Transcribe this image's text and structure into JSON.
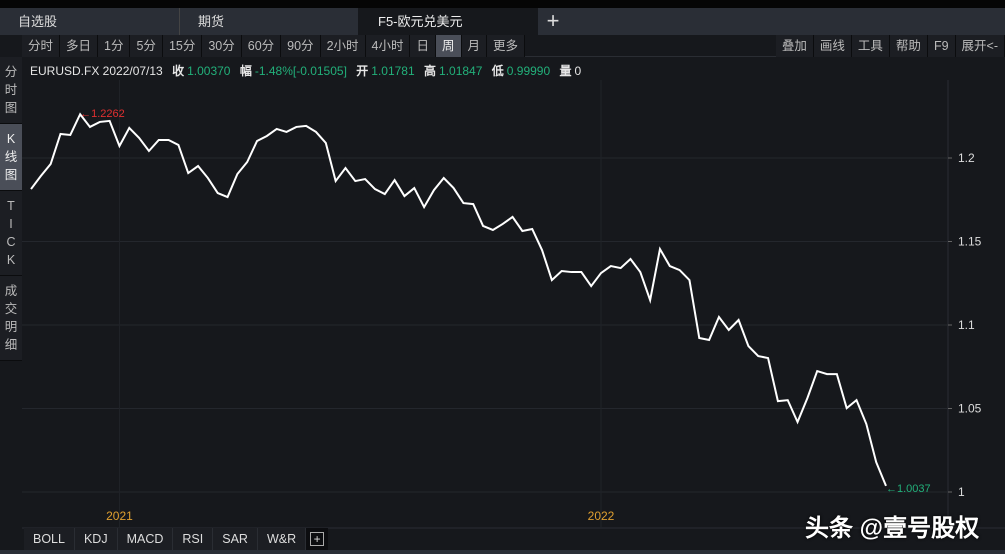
{
  "tabs": [
    {
      "label": "自选股"
    },
    {
      "label": "期货"
    },
    {
      "label": "F5-欧元兑美元 EURUSD.FX"
    }
  ],
  "add_tab": "+",
  "periods": [
    "分时",
    "多日",
    "1分",
    "5分",
    "15分",
    "30分",
    "60分",
    "90分",
    "2小时",
    "4小时",
    "日",
    "周",
    "月",
    "更多"
  ],
  "selected_period": "周",
  "tools": [
    "叠加",
    "画线",
    "工具",
    "帮助",
    "F9",
    "展开<-"
  ],
  "sidebar": [
    "分\n时\n图",
    "K\n线\n图",
    "T\nI\nC\nK",
    "成\n交\n明\n细"
  ],
  "info": {
    "symbol_date": "EURUSD.FX 2022/07/13",
    "close_label": "收",
    "close": "1.00370",
    "change_label": "幅",
    "change": "-1.48%[-0.01505]",
    "open_label": "开",
    "open": "1.01781",
    "high_label": "高",
    "high": "1.01847",
    "low_label": "低",
    "low": "0.99990",
    "vol_label": "量",
    "vol": "0"
  },
  "indicators": [
    "BOLL",
    "KDJ",
    "MACD",
    "RSI",
    "SAR",
    "W&R"
  ],
  "indicator_add": "+",
  "watermark": "头条 @壹号股权",
  "colors": {
    "up": "#22b07a",
    "max": "#e03030",
    "line": "#ffffff",
    "year": "#e0a030"
  },
  "chart_data": {
    "type": "line",
    "title": "EURUSD.FX weekly",
    "ylim": [
      1.0,
      1.25
    ],
    "yticks": [
      1,
      1.05,
      1.1,
      1.15,
      1.2
    ],
    "ytick_labels": [
      "1",
      "1.05",
      "1.1",
      "1.15",
      "1.2"
    ],
    "xtick_labels": [
      "2021",
      "2022"
    ],
    "xtick_index": [
      9,
      58
    ],
    "max_label": "1.2262",
    "max_index": 5,
    "last_label": "1.0037",
    "values": [
      1.1814,
      1.1892,
      1.1964,
      1.2144,
      1.2138,
      1.2262,
      1.2186,
      1.2216,
      1.2222,
      1.2072,
      1.218,
      1.212,
      1.2042,
      1.2108,
      1.2108,
      1.2078,
      1.191,
      1.1952,
      1.188,
      1.179,
      1.1766,
      1.1904,
      1.1976,
      1.2102,
      1.2132,
      1.2174,
      1.2156,
      1.2186,
      1.2192,
      1.2156,
      1.209,
      1.1862,
      1.194,
      1.1862,
      1.1874,
      1.1814,
      1.1784,
      1.1868,
      1.1772,
      1.182,
      1.1706,
      1.1808,
      1.188,
      1.182,
      1.173,
      1.1724,
      1.1593,
      1.1569,
      1.1605,
      1.1647,
      1.1563,
      1.1575,
      1.1449,
      1.1269,
      1.1323,
      1.1317,
      1.1317,
      1.1233,
      1.1311,
      1.1353,
      1.1341,
      1.1395,
      1.1317,
      1.1149,
      1.1455,
      1.1353,
      1.1329,
      1.1269,
      1.0922,
      1.091,
      1.1048,
      1.097,
      1.103,
      1.0874,
      1.0814,
      1.0802,
      1.0544,
      1.055,
      1.0419,
      1.0562,
      1.0724,
      1.0706,
      1.0706,
      1.0502,
      1.055,
      1.0407,
      1.0179,
      1.0037
    ]
  }
}
